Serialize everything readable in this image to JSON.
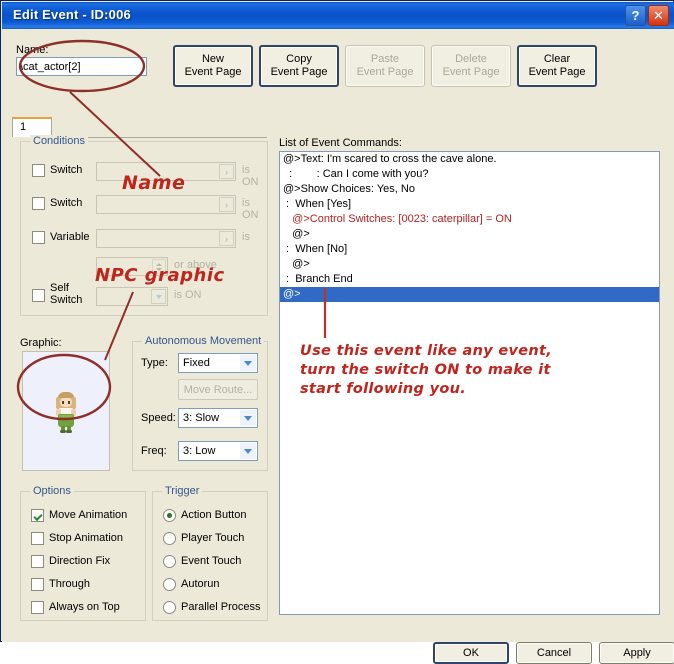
{
  "window": {
    "title": "Edit Event - ID:006",
    "help_button": "?",
    "close_button": "✕"
  },
  "name_field": {
    "label": "Name:",
    "value": "\\cat_actor[2]",
    "placeholder": ""
  },
  "page_buttons": [
    {
      "line1": "New",
      "line2": "Event Page",
      "enabled": true
    },
    {
      "line1": "Copy",
      "line2": "Event Page",
      "enabled": true
    },
    {
      "line1": "Paste",
      "line2": "Event Page",
      "enabled": false
    },
    {
      "line1": "Delete",
      "line2": "Event Page",
      "enabled": false
    },
    {
      "line1": "Clear",
      "line2": "Event Page",
      "enabled": true
    }
  ],
  "tabs": [
    {
      "label": "1",
      "active": true
    }
  ],
  "conditions": {
    "title": "Conditions",
    "rows": [
      {
        "label": "Switch",
        "value": "",
        "suffix": "is ON",
        "checked": false,
        "control": "picker"
      },
      {
        "label": "Switch",
        "value": "",
        "suffix": "is ON",
        "checked": false,
        "control": "picker"
      },
      {
        "label": "Variable",
        "value": "",
        "suffix": "is",
        "checked": false,
        "control": "picker"
      },
      {
        "label": "",
        "value": "",
        "suffix": "or above",
        "checked": false,
        "control": "spinner"
      },
      {
        "label": "Self Switch",
        "value": "",
        "suffix": "is ON",
        "checked": false,
        "control": "dropdown"
      }
    ]
  },
  "graphic": {
    "label": "Graphic:",
    "sprite_alt": "npc-character-sprite"
  },
  "autonomous_movement": {
    "title": "Autonomous Movement",
    "type_label": "Type:",
    "type_value": "Fixed",
    "move_route_button": "Move Route...",
    "speed_label": "Speed:",
    "speed_value": "3: Slow",
    "freq_label": "Freq:",
    "freq_value": "3: Low"
  },
  "options": {
    "title": "Options",
    "items": [
      {
        "label": "Move Animation",
        "checked": true
      },
      {
        "label": "Stop Animation",
        "checked": false
      },
      {
        "label": "Direction Fix",
        "checked": false
      },
      {
        "label": "Through",
        "checked": false
      },
      {
        "label": "Always on Top",
        "checked": false
      }
    ]
  },
  "trigger": {
    "title": "Trigger",
    "items": [
      {
        "label": "Action Button",
        "selected": true
      },
      {
        "label": "Player Touch",
        "selected": false
      },
      {
        "label": "Event Touch",
        "selected": false
      },
      {
        "label": "Autorun",
        "selected": false
      },
      {
        "label": "Parallel Process",
        "selected": false
      }
    ]
  },
  "command_list": {
    "label": "List of Event Commands:",
    "rows": [
      {
        "text": "@>Text: I'm scared to cross the cave alone.",
        "style": "normal"
      },
      {
        "text": "  :        : Can I come with you?",
        "style": "normal"
      },
      {
        "text": "@>Show Choices: Yes, No",
        "style": "normal"
      },
      {
        "text": " :  When [Yes]",
        "style": "normal"
      },
      {
        "text": "   @>Control Switches: [0023: caterpillar] = ON",
        "style": "red"
      },
      {
        "text": "   @>",
        "style": "normal"
      },
      {
        "text": " :  When [No]",
        "style": "normal"
      },
      {
        "text": "   @>",
        "style": "normal"
      },
      {
        "text": " :  Branch End",
        "style": "normal"
      },
      {
        "text": "@>",
        "style": "selected"
      }
    ]
  },
  "dialog_buttons": {
    "ok": "OK",
    "cancel": "Cancel",
    "apply": "Apply"
  },
  "annotations": {
    "name_callout": "Name",
    "npc_callout": "NPC graphic",
    "paragraph_line1": "Use this event like any event,",
    "paragraph_line2": "turn the switch ON to make it",
    "paragraph_line3": "start following you."
  },
  "colors": {
    "titlebar_blue": "#0a53c4",
    "annotation_red": "#c0251d",
    "selection_blue": "#316ac5",
    "dialog_face": "#ece9d8",
    "command_red": "#b22222"
  }
}
